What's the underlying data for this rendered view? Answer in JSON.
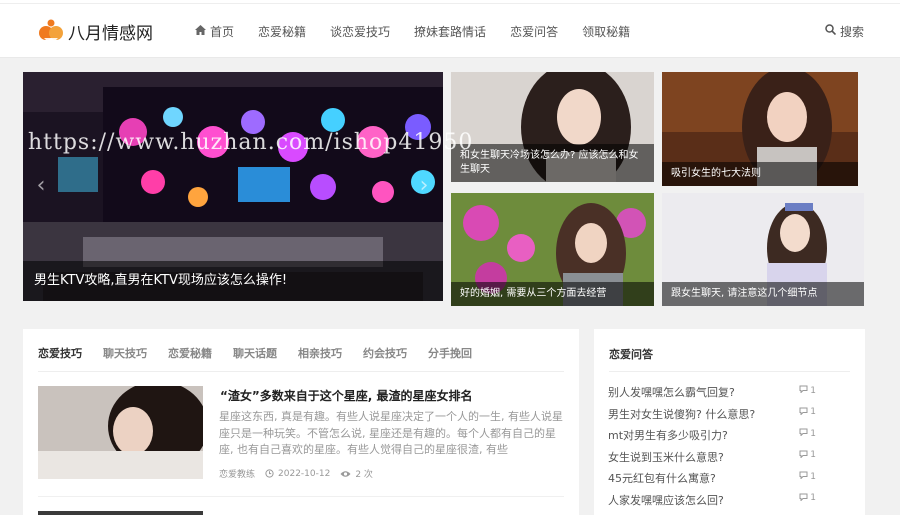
{
  "site": {
    "name": "八月情感网",
    "brand_color": "#f07a1f"
  },
  "nav": {
    "items": [
      {
        "label": "首页",
        "icon": "home-icon"
      },
      {
        "label": "恋爱秘籍"
      },
      {
        "label": "谈恋爱技巧"
      },
      {
        "label": "撩妹套路情话"
      },
      {
        "label": "恋爱问答"
      },
      {
        "label": "领取秘籍"
      }
    ],
    "search_label": "搜索"
  },
  "watermark": "https://www.huzhan.com/ishop41950",
  "hero": {
    "main": {
      "caption": "男生KTV攻略,直男在KTV现场应该怎么操作!"
    },
    "tiles": [
      {
        "caption": "和女生聊天冷场该怎么办? 应该怎么和女生聊天"
      },
      {
        "caption": "吸引女生的七大法则"
      },
      {
        "caption": "好的婚姻, 需要从三个方面去经营"
      },
      {
        "caption": "跟女生聊天, 请注意这几个细节点"
      }
    ]
  },
  "tabs": [
    "恋爱技巧",
    "聊天技巧",
    "恋爱秘籍",
    "聊天话题",
    "相亲技巧",
    "约会技巧",
    "分手挽回"
  ],
  "post": {
    "title": "“渣女”多数来自于这个星座, 最渣的星座女排名",
    "excerpt": "星座这东西, 真是有趣。有些人说星座决定了一个人的一生, 有些人说星座只是一种玩笑。不管怎么说, 星座还是有趣的。每个人都有自己的星座, 也有自己喜欢的星座。有些人觉得自己的星座很渣, 有些",
    "category": "恋爱教练",
    "date": "2022-10-12",
    "views": "2 次"
  },
  "sidebar": {
    "title": "恋爱问答",
    "items": [
      {
        "q": "别人发嘿嘿怎么霸气回复?",
        "count": "1"
      },
      {
        "q": "男生对女生说傻狗? 什么意思?",
        "count": "1"
      },
      {
        "q": "mt对男生有多少吸引力?",
        "count": "1"
      },
      {
        "q": "女生说到玉米什么意思?",
        "count": "1"
      },
      {
        "q": "45元红包有什么寓意?",
        "count": "1"
      },
      {
        "q": "人家发嘿嘿应该怎么回?",
        "count": "1"
      }
    ]
  }
}
